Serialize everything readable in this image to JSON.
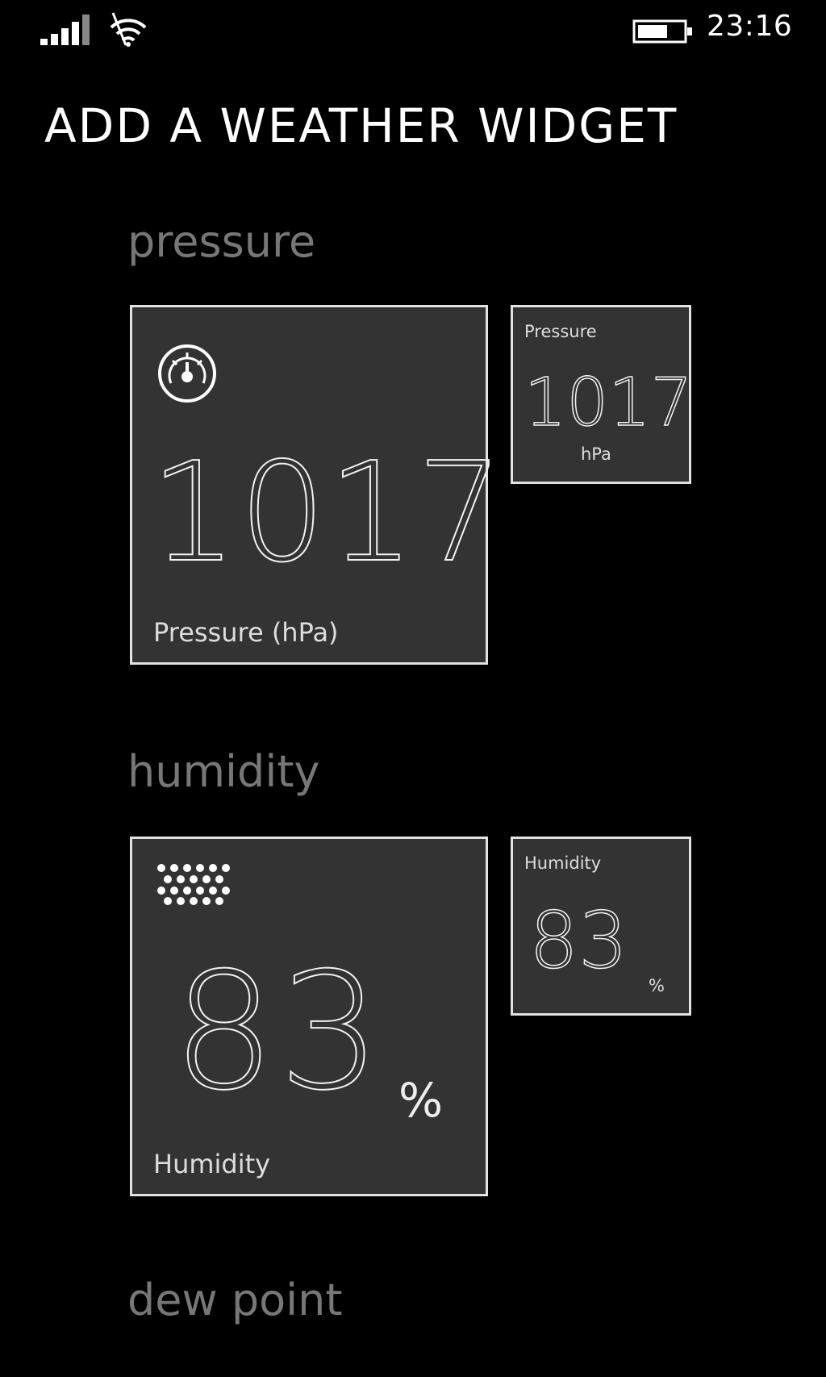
{
  "status_bar": {
    "time": "23:16",
    "signal_icon": "signal-bars-icon",
    "wifi_icon": "wifi-icon",
    "battery_icon": "battery-icon"
  },
  "page": {
    "title": "ADD A WEATHER WIDGET"
  },
  "sections": {
    "pressure": {
      "heading": "pressure",
      "large_tile": {
        "icon": "gauge-icon",
        "value": "1017",
        "label": "Pressure (hPa)"
      },
      "small_tile": {
        "caption": "Pressure",
        "value": "1017",
        "unit": "hPa"
      }
    },
    "humidity": {
      "heading": "humidity",
      "large_tile": {
        "icon": "humidity-dots-icon",
        "value": "83",
        "unit": "%",
        "label": "Humidity"
      },
      "small_tile": {
        "caption": "Humidity",
        "value": "83",
        "unit": "%"
      }
    },
    "dew_point": {
      "heading": "dew point"
    }
  },
  "colors": {
    "background": "#000000",
    "tile_background": "#333333",
    "tile_border": "#e2e2e2",
    "section_heading": "#777777"
  }
}
